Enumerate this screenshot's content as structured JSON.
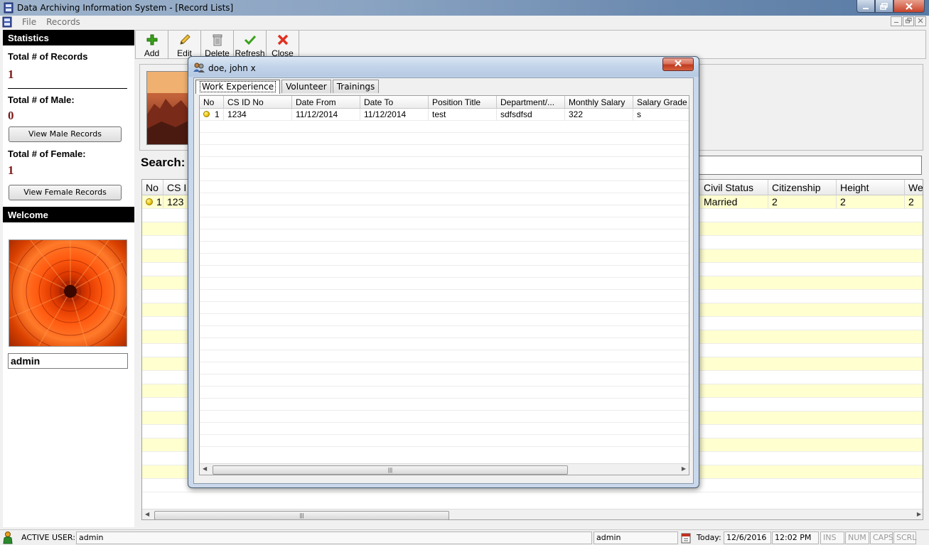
{
  "window": {
    "title": "Data Archiving Information System - [Record Lists]"
  },
  "menubar": {
    "items": [
      "File",
      "Records"
    ]
  },
  "left_panel": {
    "statistics_header": "Statistics",
    "total_records_label": "Total # of Records",
    "total_records_value": "1",
    "total_male_label": "Total # of Male:",
    "total_male_value": "0",
    "view_male_button": "View Male Records",
    "total_female_label": "Total # of Female:",
    "total_female_value": "1",
    "view_female_button": "View Female Records",
    "welcome_header": "Welcome",
    "username": "admin"
  },
  "toolbar": {
    "add": "Add",
    "edit": "Edit",
    "delete": "Delete",
    "refresh": "Refresh",
    "close": "Close"
  },
  "search": {
    "label": "Search:"
  },
  "main_grid": {
    "columns_left": [
      "No",
      "CS I"
    ],
    "columns_right": [
      "Civil Status",
      "Citizenship",
      "Height",
      "We"
    ],
    "row": {
      "no": "1",
      "cs": "123",
      "civil_status": "Married",
      "citizenship": "2",
      "height": "2",
      "weight": "2"
    }
  },
  "dialog": {
    "title": "doe, john x",
    "tabs": [
      "Work Experience",
      "Volunteer",
      "Trainings"
    ],
    "active_tab": "Work Experience",
    "columns": [
      "No",
      "CS ID No",
      "Date From",
      "Date To",
      "Position Title",
      "Department/...",
      "Monthly Salary",
      "Salary Grade"
    ],
    "rows": [
      {
        "no": "1",
        "cs_id": "1234",
        "date_from": "11/12/2014",
        "date_to": "11/12/2014",
        "position": "test",
        "department": "sdfsdfsd",
        "salary": "322",
        "grade": "s"
      }
    ]
  },
  "statusbar": {
    "active_user_label": "ACTIVE USER:",
    "active_user": "admin",
    "user_field": "admin",
    "today_label": "Today:",
    "date": "12/6/2016",
    "time": "12:02 PM",
    "ins": "INS",
    "num": "NUM",
    "caps": "CAPS",
    "scrl": "SCRL"
  }
}
